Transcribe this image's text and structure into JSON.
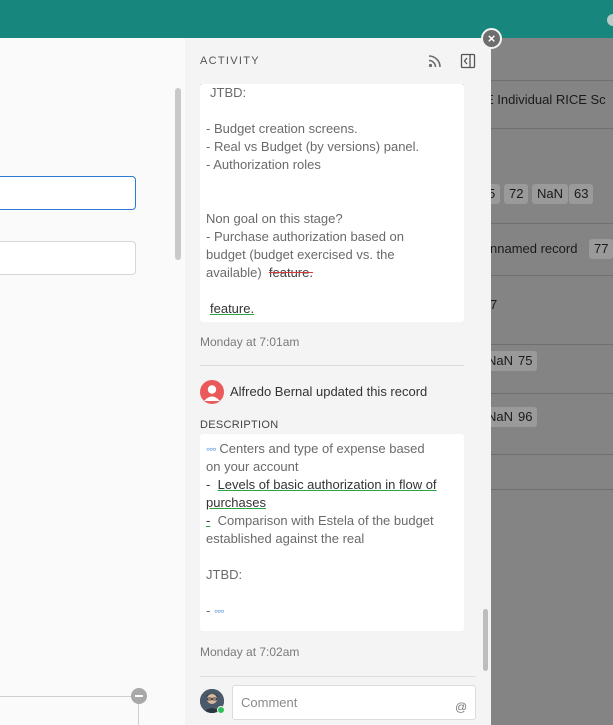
{
  "activity": {
    "title": "ACTIVITY",
    "first_card": {
      "lines": [
        "JTBD:",
        "",
        "- Budget creation screens.",
        "- Real vs Budget (by versions) panel.",
        "- Authorization roles",
        "",
        "",
        "Non goal on this stage?",
        "- Purchase authorization based on",
        "budget (budget exercised vs. the"
      ],
      "available_text": "available)",
      "removed_text": "feature.",
      "added_text": "feature.",
      "timestamp": "Monday at 7:01am"
    },
    "update": {
      "user_text": "Alfredo Bernal updated this record",
      "field_label": "DESCRIPTION",
      "ellipsis": "◦◦◦",
      "line1_suffix": "Centers and type of expense based",
      "line2": "on your account",
      "line3_prefix": "-",
      "line3_added": "Levels of basic authorization in flow of",
      "line4_added": "purchases",
      "line5_added_dash": "-",
      "line5_rest": "Comparison with Estela of the budget",
      "line6": "established against the real",
      "line8": "JTBD:",
      "line10_prefix": "-",
      "timestamp": "Monday at 7:02am"
    },
    "comment_placeholder": "Comment",
    "at_symbol": "@",
    "close_symbol": "×"
  },
  "grid": {
    "header": "E Individual RICE Sc",
    "rows": [
      {
        "cells": [
          "5",
          "72",
          "NaN",
          "63"
        ]
      },
      {
        "text": "nnamed record",
        "cells": [
          "77"
        ]
      },
      {
        "text": "7"
      },
      {
        "cells": [
          "NaN",
          "75"
        ]
      },
      {
        "cells": [
          "NaN",
          "96"
        ]
      }
    ]
  },
  "colors": {
    "topbar": "#17877d",
    "added_underline": "#27a547",
    "removed_strike": "#d23c3c",
    "avatar_red": "#ea5a5a",
    "focus_blue": "#2d7ad6"
  },
  "icons": {
    "feed": "rss-icon",
    "panel": "collapse-panel-icon",
    "close": "close-icon",
    "mention": "at-icon"
  }
}
